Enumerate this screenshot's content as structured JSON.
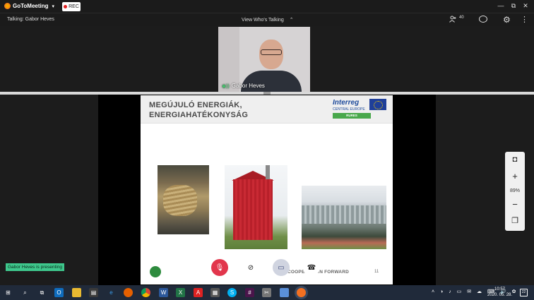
{
  "app": {
    "brand": "GoToMeeting",
    "rec_label": "REC"
  },
  "window_controls": {
    "minimize": "—",
    "restore": "⧉",
    "close": "✕"
  },
  "infobar": {
    "talking": "Talking: Gabor Heves",
    "view_who": "View Who's Talking",
    "attendee_count": "40"
  },
  "webcam": {
    "name": "Gabor Heves"
  },
  "slide": {
    "title_line1": "MEGÚJULÓ ENERGIÁK,",
    "title_line2": "ENERGIAHATÉKONYSÁG",
    "logo_name": "Interreg",
    "logo_sub": "CENTRAL EUROPE",
    "logo_tag": "RURES",
    "footer_text": "COOPERATION FORWARD",
    "page_number": "11"
  },
  "controls": {
    "mic_label": "Mic",
    "camera_label": "Camera",
    "screen_label": "Screen",
    "leave_label": "Leave"
  },
  "side_toolbar": {
    "zoom": "89%"
  },
  "presenting_badge": "Gabor Heves is presenting",
  "taskbar": {
    "time": "10:57",
    "date": "2020. 05. 28.",
    "notification_count": "22",
    "apps": [
      "start",
      "search",
      "task-view",
      "outlook",
      "file-explorer",
      "store",
      "edge",
      "firefox",
      "chrome",
      "word",
      "excel",
      "acrobat",
      "calculator",
      "skype",
      "slack",
      "snip",
      "paint",
      "gotomeeting"
    ]
  },
  "colors": {
    "accent_green": "#3ec78c",
    "mic_red": "#e2364c",
    "interreg_blue": "#1f4c9c",
    "rures_green": "#49a84c",
    "taskbar": "#202a3a"
  }
}
